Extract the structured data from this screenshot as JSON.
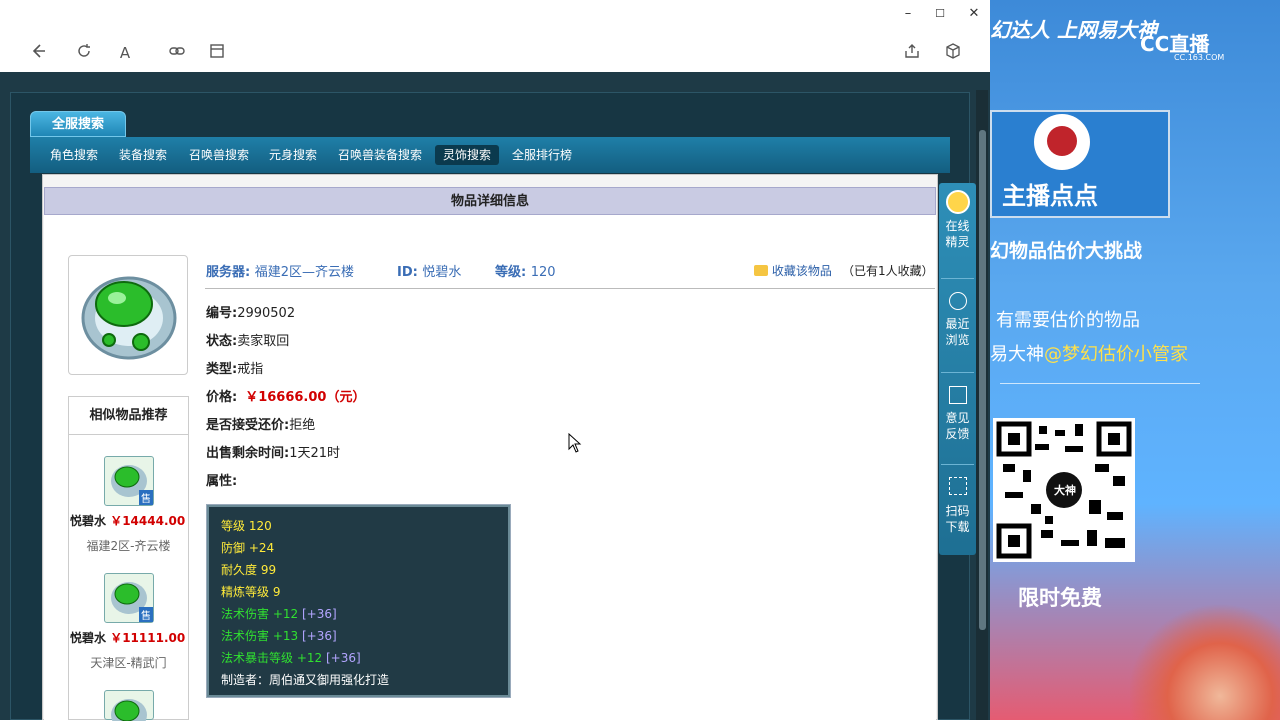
{
  "browser": {
    "window_controls": {
      "minimize": "–",
      "maximize": "☐",
      "close": "✕"
    },
    "nav_icons": [
      "back-icon",
      "refresh-icon",
      "font-icon",
      "link-icon",
      "tab-icon",
      "share-icon",
      "cube-icon"
    ]
  },
  "tabs": {
    "main": "全服搜索"
  },
  "nav": [
    "角色搜索",
    "装备搜索",
    "召唤兽搜索",
    "元身搜索",
    "召唤兽装备搜索",
    "灵饰搜索",
    "全服排行榜"
  ],
  "detail": {
    "header": "物品详细信息",
    "server_label": "服务器:",
    "server_value": "福建2区—齐云楼",
    "id_label": "ID:",
    "id_value": "悦碧水",
    "level_label": "等级:",
    "level_value": "120",
    "favorite": "收藏该物品",
    "favorite_count": "（已有1人收藏）",
    "number_label": "编号:",
    "number_value": "2990502",
    "status_label": "状态:",
    "status_value": "卖家取回",
    "type_label": "类型:",
    "type_value": "戒指",
    "price_label": "价格:",
    "price_value": "￥16666.00（元）",
    "bargain_label": "是否接受还价:",
    "bargain_value": "拒绝",
    "time_label": "出售剩余时间:",
    "time_value": "1天21时",
    "attr_label": "属性:"
  },
  "attributes": [
    {
      "text": "等级 120",
      "color": "#ffea3a"
    },
    {
      "text": "防御 +24",
      "color": "#ffea3a"
    },
    {
      "text": "耐久度 99",
      "color": "#ffea3a"
    },
    {
      "text": "精炼等级 9",
      "color": "#ffea3a"
    }
  ],
  "attributes_extra": [
    {
      "text": "法术伤害 +12",
      "bonus": "[+36]"
    },
    {
      "text": "法术伤害 +13",
      "bonus": "[+36]"
    },
    {
      "text": "法术暴击等级 +12",
      "bonus": "[+36]"
    }
  ],
  "maker": "制造者：周伯通又御用强化打造",
  "recommend": {
    "title": "相似物品推荐",
    "items": [
      {
        "name": "悦碧水",
        "price": "￥14444.00",
        "server": "福建2区-齐云楼"
      },
      {
        "name": "悦碧水",
        "price": "￥11111.00",
        "server": "天津区-精武门"
      }
    ],
    "sell_badge": "售"
  },
  "side_panel": [
    {
      "label1": "在线",
      "label2": "精灵",
      "icon": "sprite-icon"
    },
    {
      "label1": "最近",
      "label2": "浏览",
      "icon": "clock-icon"
    },
    {
      "label1": "意见",
      "label2": "反馈",
      "icon": "edit-icon"
    },
    {
      "label1": "扫码",
      "label2": "下载",
      "icon": "scan-icon"
    }
  ],
  "stream": {
    "top_banner": "幻达人 上网易大神",
    "cc_logo": "CC直播",
    "cc_url": "CC.163.COM",
    "host": "主播点点",
    "line1": "幻物品估价大挑战",
    "line2": "有需要估价的物品",
    "line3_a": "易大神",
    "line3_b": "@梦幻估价小管家",
    "qr_center": "大神",
    "free": "限时免费"
  }
}
